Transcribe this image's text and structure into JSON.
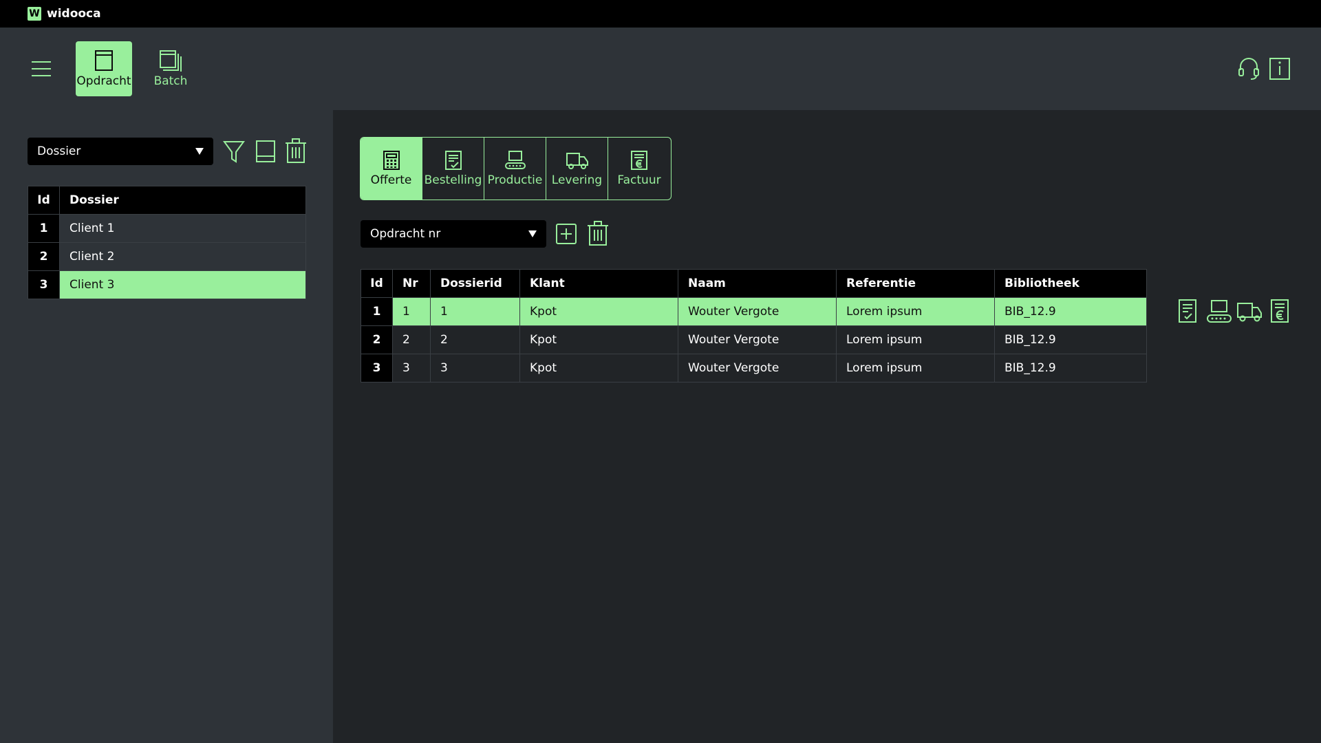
{
  "app": {
    "logo_letter": "W",
    "title": "widooca"
  },
  "toolbar": {
    "modes": [
      {
        "label": "Opdracht",
        "icon": "book-icon",
        "active": true
      },
      {
        "label": "Batch",
        "icon": "stacked-pages-icon",
        "active": false
      }
    ],
    "right_icons": [
      "headset-icon",
      "info-icon"
    ]
  },
  "left": {
    "select": {
      "value": "Dossier"
    },
    "actions": [
      "filter-icon",
      "book-icon",
      "trash-icon"
    ],
    "table": {
      "headers": [
        "Id",
        "Dossier"
      ],
      "rows": [
        {
          "id": "1",
          "dossier": "Client 1",
          "selected": false
        },
        {
          "id": "2",
          "dossier": "Client 2",
          "selected": false
        },
        {
          "id": "3",
          "dossier": "Client 3",
          "selected": true
        }
      ]
    }
  },
  "main": {
    "tabs": [
      {
        "label": "Offerte",
        "icon": "calculator-icon",
        "active": true
      },
      {
        "label": "Bestelling",
        "icon": "checklist-icon",
        "active": false
      },
      {
        "label": "Productie",
        "icon": "conveyor-icon",
        "active": false
      },
      {
        "label": "Levering",
        "icon": "truck-icon",
        "active": false
      },
      {
        "label": "Factuur",
        "icon": "invoice-icon",
        "active": false
      }
    ],
    "select": {
      "value": "Opdracht nr"
    },
    "actions": [
      "add-icon",
      "trash-icon"
    ],
    "table": {
      "headers": [
        "Id",
        "Nr",
        "Dossierid",
        "Klant",
        "Naam",
        "Referentie",
        "Bibliotheek"
      ],
      "rows": [
        {
          "id": "1",
          "nr": "1",
          "dossierid": "1",
          "klant": "Kpot",
          "naam": "Wouter Vergote",
          "referentie": "Lorem ipsum",
          "bibliotheek": "BIB_12.9",
          "selected": true
        },
        {
          "id": "2",
          "nr": "2",
          "dossierid": "2",
          "klant": "Kpot",
          "naam": "Wouter Vergote",
          "referentie": "Lorem ipsum",
          "bibliotheek": "BIB_12.9",
          "selected": false
        },
        {
          "id": "3",
          "nr": "3",
          "dossierid": "3",
          "klant": "Kpot",
          "naam": "Wouter Vergote",
          "referentie": "Lorem ipsum",
          "bibliotheek": "BIB_12.9",
          "selected": false
        }
      ]
    },
    "row_actions": [
      "checklist-icon",
      "conveyor-icon",
      "truck-icon",
      "invoice-icon"
    ]
  },
  "colors": {
    "accent": "#99ef9c",
    "background": "#212427",
    "panel": "#2e3338",
    "titlebar": "#000000"
  }
}
